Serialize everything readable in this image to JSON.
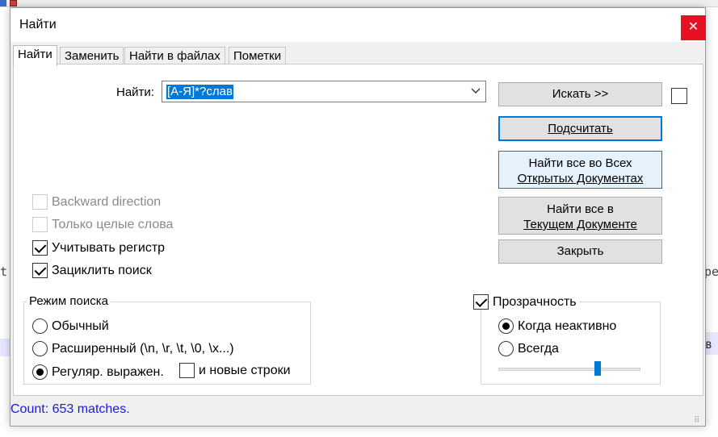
{
  "dialog": {
    "title": "Найти",
    "close_glyph": "✕"
  },
  "tabs": [
    {
      "label": "Найти",
      "active": true
    },
    {
      "label": "Заменить",
      "active": false
    },
    {
      "label": "Найти в файлах",
      "active": false
    },
    {
      "label": "Пометки",
      "active": false
    }
  ],
  "search": {
    "label": "Найти:",
    "value": "[А-Я]*?слав",
    "dropdown_icon": "chevron-down-icon"
  },
  "buttons": {
    "find_next": "Искать >>",
    "count": "Подсчитать",
    "find_all_open_docs_line1": "Найти все во Всех",
    "find_all_open_docs_line2": "Открытых Документах",
    "find_all_current_line1": "Найти все в",
    "find_all_current_line2": "Текущем Документе",
    "close": "Закрыть"
  },
  "options": {
    "backward": {
      "label": "Backward direction",
      "checked": false,
      "enabled": false
    },
    "whole_word": {
      "label": "Только целые слова",
      "checked": false,
      "enabled": false
    },
    "match_case": {
      "label": "Учитывать регистр",
      "checked": true,
      "enabled": true
    },
    "wrap_around": {
      "label": "Зациклить поиск",
      "checked": true,
      "enabled": true
    }
  },
  "search_mode": {
    "title": "Режим поиска",
    "normal": "Обычный",
    "extended": "Расширенный (\\n, \\r, \\t, \\0, \\x...)",
    "regex": "Регуляр. выражен.",
    "dot_newline": "и новые строки",
    "selected": "regex"
  },
  "transparency": {
    "label": "Прозрачность",
    "checked": true,
    "on_lose_focus": "Когда неактивно",
    "always": "Всегда",
    "selected": "on_lose_focus",
    "level": 0.7
  },
  "status": "Count: 653 matches.",
  "background": {
    "left_snip": "t",
    "right_snip": "pe",
    "right_snip2": "ов"
  },
  "colors": {
    "accent": "#0078d7",
    "close_red": "#e81123",
    "status_blue": "#1a1adb"
  }
}
